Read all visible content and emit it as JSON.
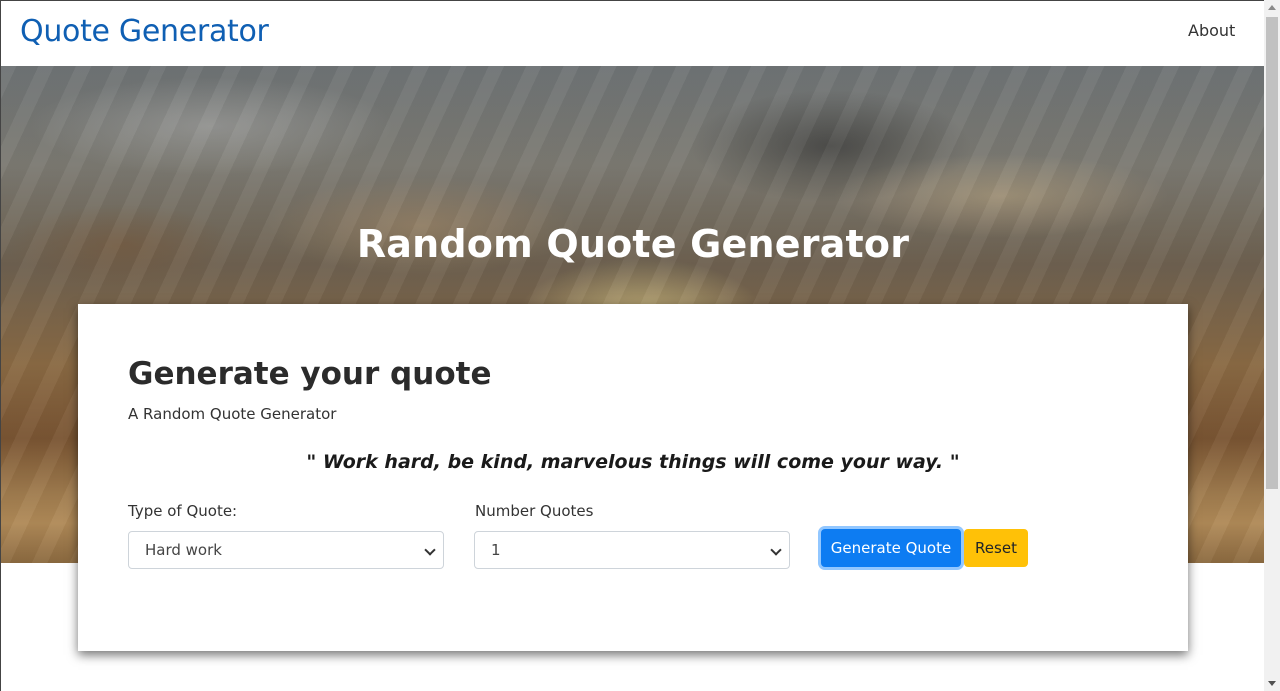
{
  "navbar": {
    "brand": "Quote Generator",
    "links": [
      {
        "label": "About"
      }
    ]
  },
  "hero": {
    "title": "Random Quote Generator"
  },
  "card": {
    "title": "Generate your quote",
    "subtitle": "A Random Quote Generator",
    "quote": "\" Work hard, be kind, marvelous things will come your way. \"",
    "type_field": {
      "label": "Type of Quote:",
      "value": "Hard work"
    },
    "number_field": {
      "label": "Number Quotes",
      "value": "1"
    },
    "generate_label": "Generate Quote",
    "reset_label": "Reset"
  },
  "colors": {
    "brand": "#0f5fb3",
    "primary_button": "#0d7cf2",
    "warning_button": "#ffc107"
  }
}
